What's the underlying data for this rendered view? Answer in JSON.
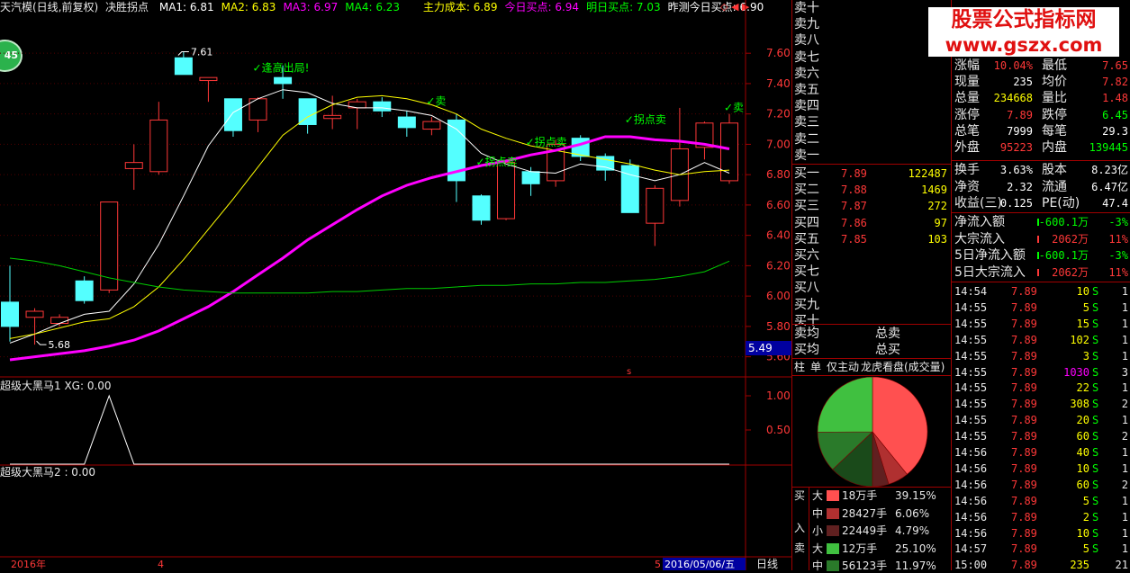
{
  "header": {
    "stock_name": "天汽模(日线,前复权)",
    "formula": "决胜拐点",
    "ma_items": [
      {
        "label": "MA1:",
        "value": "6.81",
        "color": "#ffffff"
      },
      {
        "label": "MA2:",
        "value": "6.83",
        "color": "#ffff00"
      },
      {
        "label": "MA3:",
        "value": "6.97",
        "color": "#ff00ff"
      },
      {
        "label": "MA4:",
        "value": "6.23",
        "color": "#00ff00"
      }
    ],
    "extra_items": [
      {
        "label": "主力成本:",
        "value": "6.89",
        "color": "#ffff00"
      },
      {
        "label": "今日买点:",
        "value": "6.94",
        "color": "#ff00ff"
      },
      {
        "label": "明日买点:",
        "value": "7.03",
        "color": "#00ff00"
      },
      {
        "label": "昨测今日买点:",
        "value": "6.90",
        "color": "#ffffff"
      }
    ],
    "nav_icons": "◇ ◀ ▶"
  },
  "badge": "45",
  "banner": {
    "line1": "股票公式指标网",
    "line2": "www.gszx.com"
  },
  "chart_data": [
    {
      "type": "candlestick",
      "title": "天汽模(日线,前复权)",
      "y_ticks": [
        "7.60",
        "7.40",
        "7.20",
        "7.00",
        "6.80",
        "6.60",
        "6.40",
        "6.20",
        "6.00",
        "5.80",
        "5.60"
      ],
      "ylim": [
        5.58,
        7.85
      ],
      "current_price_label": "5.49",
      "high_marker": "7.61",
      "low_marker": "5.68",
      "candles": [
        {
          "o": 5.96,
          "c": 5.8,
          "h": 6.2,
          "l": 5.7
        },
        {
          "o": 5.86,
          "c": 5.9,
          "h": 5.92,
          "l": 5.68
        },
        {
          "o": 5.82,
          "c": 5.86,
          "h": 5.88,
          "l": 5.8
        },
        {
          "o": 6.1,
          "c": 5.97,
          "h": 6.13,
          "l": 5.95
        },
        {
          "o": 6.04,
          "c": 6.62,
          "h": 6.62,
          "l": 6.02
        },
        {
          "o": 6.84,
          "c": 6.88,
          "h": 7.0,
          "l": 6.7
        },
        {
          "o": 6.82,
          "c": 7.16,
          "h": 7.28,
          "l": 6.8
        },
        {
          "o": 7.57,
          "c": 7.46,
          "h": 7.61,
          "l": 7.46
        },
        {
          "o": 7.42,
          "c": 7.44,
          "h": 7.44,
          "l": 7.28
        },
        {
          "o": 7.3,
          "c": 7.09,
          "h": 7.3,
          "l": 7.05
        },
        {
          "o": 7.16,
          "c": 7.3,
          "h": 7.31,
          "l": 7.08
        },
        {
          "o": 7.44,
          "c": 7.4,
          "h": 7.52,
          "l": 7.3
        },
        {
          "o": 7.3,
          "c": 7.13,
          "h": 7.3,
          "l": 7.07
        },
        {
          "o": 7.17,
          "c": 7.19,
          "h": 7.32,
          "l": 7.1
        },
        {
          "o": 7.24,
          "c": 7.28,
          "h": 7.3,
          "l": 7.1
        },
        {
          "o": 7.28,
          "c": 7.22,
          "h": 7.31,
          "l": 7.18
        },
        {
          "o": 7.18,
          "c": 7.11,
          "h": 7.22,
          "l": 7.05
        },
        {
          "o": 7.1,
          "c": 7.15,
          "h": 7.18,
          "l": 7.06
        },
        {
          "o": 7.16,
          "c": 6.76,
          "h": 7.2,
          "l": 6.62
        },
        {
          "o": 6.66,
          "c": 6.5,
          "h": 6.67,
          "l": 6.47
        },
        {
          "o": 6.51,
          "c": 6.88,
          "h": 6.9,
          "l": 6.5
        },
        {
          "o": 6.82,
          "c": 6.74,
          "h": 6.85,
          "l": 6.66
        },
        {
          "o": 6.76,
          "c": 7.0,
          "h": 7.03,
          "l": 6.72
        },
        {
          "o": 7.04,
          "c": 6.92,
          "h": 7.06,
          "l": 6.89
        },
        {
          "o": 6.92,
          "c": 6.83,
          "h": 6.94,
          "l": 6.76
        },
        {
          "o": 6.86,
          "c": 6.55,
          "h": 6.9,
          "l": 6.55
        },
        {
          "o": 6.48,
          "c": 6.71,
          "h": 6.73,
          "l": 6.33
        },
        {
          "o": 6.63,
          "c": 6.97,
          "h": 7.24,
          "l": 6.59
        },
        {
          "o": 6.98,
          "c": 7.14,
          "h": 7.15,
          "l": 6.9
        },
        {
          "o": 6.76,
          "c": 7.14,
          "h": 7.2,
          "l": 6.74
        }
      ],
      "series": [
        {
          "name": "MA1",
          "color": "#ffffff",
          "values": [
            5.69,
            5.75,
            5.82,
            5.88,
            5.9,
            6.08,
            6.34,
            6.66,
            6.99,
            7.21,
            7.3,
            7.36,
            7.34,
            7.27,
            7.24,
            7.24,
            7.22,
            7.19,
            7.1,
            6.94,
            6.87,
            6.82,
            6.81,
            6.87,
            6.85,
            6.8,
            6.76,
            6.8,
            6.88,
            6.81
          ]
        },
        {
          "name": "MA2",
          "color": "#ffff00",
          "values": [
            5.72,
            5.75,
            5.79,
            5.83,
            5.85,
            5.93,
            6.06,
            6.24,
            6.44,
            6.64,
            6.85,
            7.06,
            7.18,
            7.26,
            7.31,
            7.32,
            7.3,
            7.26,
            7.2,
            7.1,
            7.04,
            6.99,
            6.96,
            6.93,
            6.9,
            6.87,
            6.83,
            6.8,
            6.82,
            6.83
          ]
        },
        {
          "name": "MA3",
          "color": "#ff00ff",
          "values": [
            5.58,
            5.6,
            5.62,
            5.64,
            5.67,
            5.71,
            5.77,
            5.85,
            5.93,
            6.03,
            6.14,
            6.25,
            6.37,
            6.47,
            6.57,
            6.66,
            6.73,
            6.78,
            6.82,
            6.86,
            6.89,
            6.93,
            6.96,
            7.0,
            7.05,
            7.05,
            7.03,
            7.02,
            7.0,
            6.97
          ]
        },
        {
          "name": "MA4",
          "color": "#00cc00",
          "values": [
            6.25,
            6.23,
            6.2,
            6.16,
            6.12,
            6.09,
            6.06,
            6.04,
            6.03,
            6.02,
            6.02,
            6.02,
            6.02,
            6.03,
            6.03,
            6.04,
            6.05,
            6.05,
            6.06,
            6.07,
            6.07,
            6.08,
            6.08,
            6.09,
            6.09,
            6.1,
            6.11,
            6.13,
            6.16,
            6.23
          ]
        }
      ],
      "annotations": [
        {
          "text": "逢高出局!",
          "i": 10,
          "y": 7.48,
          "color": "#00ff00"
        },
        {
          "text": "卖",
          "i": 17,
          "y": 7.26,
          "color": "#00ff00"
        },
        {
          "text": "拐点卖",
          "i": 19,
          "y": 6.86,
          "color": "#00ff00"
        },
        {
          "text": "拐点卖",
          "i": 21,
          "y": 6.99,
          "color": "#00ff00"
        },
        {
          "text": "拐点卖",
          "i": 25,
          "y": 7.14,
          "color": "#00ff00"
        },
        {
          "text": "卖",
          "i": 29,
          "y": 7.22,
          "color": "#00ff00"
        }
      ],
      "x_labels": [
        {
          "text": "2016年",
          "color": "#ff3838"
        },
        {
          "text": "4",
          "color": "#ff3838"
        },
        {
          "text": "5",
          "color": "#ff3838"
        },
        {
          "text": "2016/05/06/五",
          "color": "#ffffff"
        }
      ]
    },
    {
      "type": "line",
      "title": "超级大黑马1 XG: 0.00",
      "y_ticks": [
        "1.00",
        "0.50"
      ],
      "ylim": [
        0,
        1
      ],
      "series": [
        {
          "name": "XG",
          "color": "#ffffff",
          "values": [
            0,
            0,
            0,
            0,
            1,
            0,
            0,
            0,
            0,
            0,
            0,
            0,
            0,
            0,
            0,
            0,
            0,
            0,
            0,
            0,
            0,
            0,
            0,
            0,
            0,
            0,
            0,
            0,
            0,
            0
          ]
        }
      ]
    },
    {
      "type": "line",
      "title": "超级大黑马2 : 0.00",
      "series": []
    },
    {
      "type": "pie",
      "title": "龙虎看盘(成交量)",
      "categories": [
        "买大",
        "买中",
        "买小",
        "卖大",
        "卖中",
        "卖小"
      ],
      "values": [
        39.15,
        6.06,
        4.79,
        25.1,
        11.97,
        12.93
      ]
    }
  ],
  "order_book": {
    "sells": [
      "卖十",
      "卖九",
      "卖八",
      "卖七",
      "卖六",
      "卖五",
      "卖四",
      "卖三",
      "卖二",
      "卖一"
    ],
    "buys": [
      {
        "label": "买一",
        "price": "7.89",
        "vol": "122487"
      },
      {
        "label": "买二",
        "price": "7.88",
        "vol": "1469"
      },
      {
        "label": "买三",
        "price": "7.87",
        "vol": "272"
      },
      {
        "label": "买四",
        "price": "7.86",
        "vol": "97"
      },
      {
        "label": "买五",
        "price": "7.85",
        "vol": "103"
      },
      {
        "label": "买六",
        "price": "",
        "vol": ""
      },
      {
        "label": "买七",
        "price": "",
        "vol": ""
      },
      {
        "label": "买八",
        "price": "",
        "vol": ""
      },
      {
        "label": "买九",
        "price": "",
        "vol": ""
      },
      {
        "label": "买十",
        "price": "",
        "vol": ""
      }
    ],
    "avg_sell": "卖均",
    "avg_buy": "买均",
    "total_sell": "总卖",
    "total_buy": "总买",
    "tabs": [
      "柱",
      "单",
      "仅主动",
      "龙虎看盘(成交量)"
    ]
  },
  "flow_legend": {
    "side_labels": [
      "买",
      "入",
      "卖"
    ],
    "rows": [
      {
        "size": "大",
        "color": "#ff5050",
        "amount": "18万手",
        "pct": "39.15%"
      },
      {
        "size": "中",
        "color": "#b03030",
        "amount": "28427手",
        "pct": "6.06%"
      },
      {
        "size": "小",
        "color": "#602020",
        "amount": "22449手",
        "pct": "4.79%"
      },
      {
        "size": "大",
        "color": "#40c040",
        "amount": "12万手",
        "pct": "25.10%"
      },
      {
        "size": "中",
        "color": "#2a7a2a",
        "amount": "56123手",
        "pct": "11.97%"
      }
    ]
  },
  "quote": {
    "rows": [
      {
        "l1": "涨幅",
        "v1": "10.04%",
        "c1": "#ff3838",
        "l2": "最低",
        "v2": "7.65",
        "c2": "#ff3838"
      },
      {
        "l1": "现量",
        "v1": "235",
        "c1": "#ffffff",
        "l2": "均价",
        "v2": "7.82",
        "c2": "#ff3838"
      },
      {
        "l1": "总量",
        "v1": "234668",
        "c1": "#ffff00",
        "l2": "量比",
        "v2": "1.48",
        "c2": "#ff3838"
      },
      {
        "l1": "涨停",
        "v1": "7.89",
        "c1": "#ff3838",
        "l2": "跌停",
        "v2": "6.45",
        "c2": "#00ff00"
      },
      {
        "l1": "总笔",
        "v1": "7999",
        "c1": "#ffffff",
        "l2": "每笔",
        "v2": "29.3",
        "c2": "#ffffff"
      },
      {
        "l1": "外盘",
        "v1": "95223",
        "c1": "#ff3838",
        "l2": "内盘",
        "v2": "139445",
        "c2": "#00ff00"
      }
    ],
    "rows2": [
      {
        "l1": "换手",
        "v1": "3.63%",
        "l2": "股本",
        "v2": "8.23亿"
      },
      {
        "l1": "净资",
        "v1": "2.32",
        "l2": "流通",
        "v2": "6.47亿"
      },
      {
        "l1": "收益(三)",
        "v1": "0.125",
        "l2": "PE(动)",
        "v2": "47.4"
      }
    ],
    "flows": [
      {
        "label": "净流入额",
        "value": "-600.1万",
        "pct": "-3%",
        "vcolor": "#00ff00",
        "pcolor": "#00ff00"
      },
      {
        "label": "大宗流入",
        "value": "2062万",
        "pct": "11%",
        "vcolor": "#ff3838",
        "pcolor": "#ff3838"
      },
      {
        "label": "5日净流入额",
        "value": "-600.1万",
        "pct": "-3%",
        "vcolor": "#00ff00",
        "pcolor": "#00ff00"
      },
      {
        "label": "5日大宗流入",
        "value": "2062万",
        "pct": "11%",
        "vcolor": "#ff3838",
        "pcolor": "#ff3838"
      }
    ]
  },
  "ticks": [
    {
      "t": "14:54",
      "p": "7.89",
      "v": "10",
      "s": "S",
      "n": "1",
      "vc": "#ffff00"
    },
    {
      "t": "14:55",
      "p": "7.89",
      "v": "5",
      "s": "S",
      "n": "1",
      "vc": "#ffff00"
    },
    {
      "t": "14:55",
      "p": "7.89",
      "v": "15",
      "s": "S",
      "n": "1",
      "vc": "#ffff00"
    },
    {
      "t": "14:55",
      "p": "7.89",
      "v": "102",
      "s": "S",
      "n": "1",
      "vc": "#ffff00"
    },
    {
      "t": "14:55",
      "p": "7.89",
      "v": "3",
      "s": "S",
      "n": "1",
      "vc": "#ffff00"
    },
    {
      "t": "14:55",
      "p": "7.89",
      "v": "1030",
      "s": "S",
      "n": "3",
      "vc": "#ff00ff"
    },
    {
      "t": "14:55",
      "p": "7.89",
      "v": "22",
      "s": "S",
      "n": "1",
      "vc": "#ffff00"
    },
    {
      "t": "14:55",
      "p": "7.89",
      "v": "308",
      "s": "S",
      "n": "2",
      "vc": "#ffff00"
    },
    {
      "t": "14:55",
      "p": "7.89",
      "v": "20",
      "s": "S",
      "n": "1",
      "vc": "#ffff00"
    },
    {
      "t": "14:55",
      "p": "7.89",
      "v": "60",
      "s": "S",
      "n": "2",
      "vc": "#ffff00"
    },
    {
      "t": "14:56",
      "p": "7.89",
      "v": "40",
      "s": "S",
      "n": "1",
      "vc": "#ffff00"
    },
    {
      "t": "14:56",
      "p": "7.89",
      "v": "10",
      "s": "S",
      "n": "1",
      "vc": "#ffff00"
    },
    {
      "t": "14:56",
      "p": "7.89",
      "v": "60",
      "s": "S",
      "n": "2",
      "vc": "#ffff00"
    },
    {
      "t": "14:56",
      "p": "7.89",
      "v": "5",
      "s": "S",
      "n": "1",
      "vc": "#ffff00"
    },
    {
      "t": "14:56",
      "p": "7.89",
      "v": "2",
      "s": "S",
      "n": "1",
      "vc": "#ffff00"
    },
    {
      "t": "14:56",
      "p": "7.89",
      "v": "10",
      "s": "S",
      "n": "1",
      "vc": "#ffff00"
    },
    {
      "t": "14:57",
      "p": "7.89",
      "v": "5",
      "s": "S",
      "n": "1",
      "vc": "#ffff00"
    },
    {
      "t": "15:00",
      "p": "7.89",
      "v": "235",
      "s": "",
      "n": "21",
      "vc": "#ffff00"
    }
  ],
  "period_tab": "日线"
}
